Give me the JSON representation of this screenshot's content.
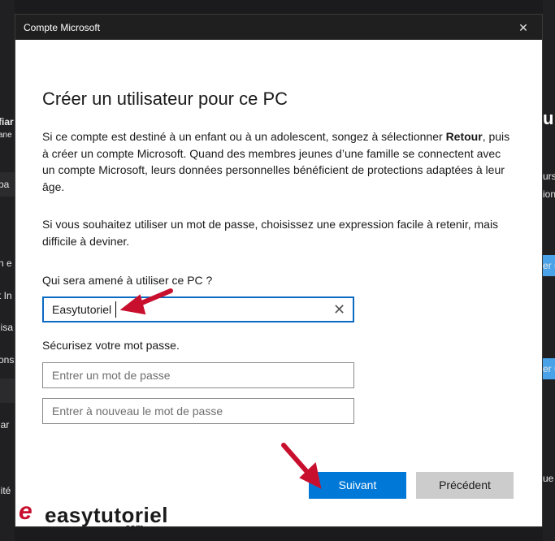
{
  "background": {
    "left_fragments": [
      "fiar",
      "ane",
      "pa",
      "n e",
      "t In",
      "lisa",
      "ons",
      "lar",
      "lité"
    ],
    "right_fragments": [
      "u",
      "urs",
      "ions",
      "er u",
      "er u",
      "ue"
    ]
  },
  "dialog": {
    "window_title": "Compte Microsoft",
    "close_glyph": "✕",
    "heading": "Créer un utilisateur pour ce PC",
    "para1_pre": "Si ce compte est destiné à un enfant ou à un adolescent, songez à sélectionner ",
    "para1_bold": "Retour",
    "para1_post": ", puis à créer un compte Microsoft. Quand des membres jeunes d’une famille se connectent avec un compte Microsoft, leurs données personnelles bénéficient de protections adaptées à leur âge.",
    "para2": "Si vous souhaitez utiliser un mot de passe, choisissez une expression facile à retenir, mais difficile à deviner.",
    "user_label": "Qui sera amené à utiliser ce PC ?",
    "user_value": "Easytutoriel",
    "clear_glyph": "✕",
    "password_label": "Sécurisez votre mot passe.",
    "password_placeholder": "Entrer un mot de passe",
    "password_confirm_placeholder": "Entrer à nouveau le mot de passe",
    "next_button": "Suivant",
    "back_button": "Précédent"
  },
  "watermark": {
    "mark": "e",
    "word": "easytutoriel",
    "suffix": ".com"
  },
  "colors": {
    "accent": "#0078d7",
    "annotation_arrow": "#c8102e",
    "titlebar": "#1f1f1f"
  }
}
